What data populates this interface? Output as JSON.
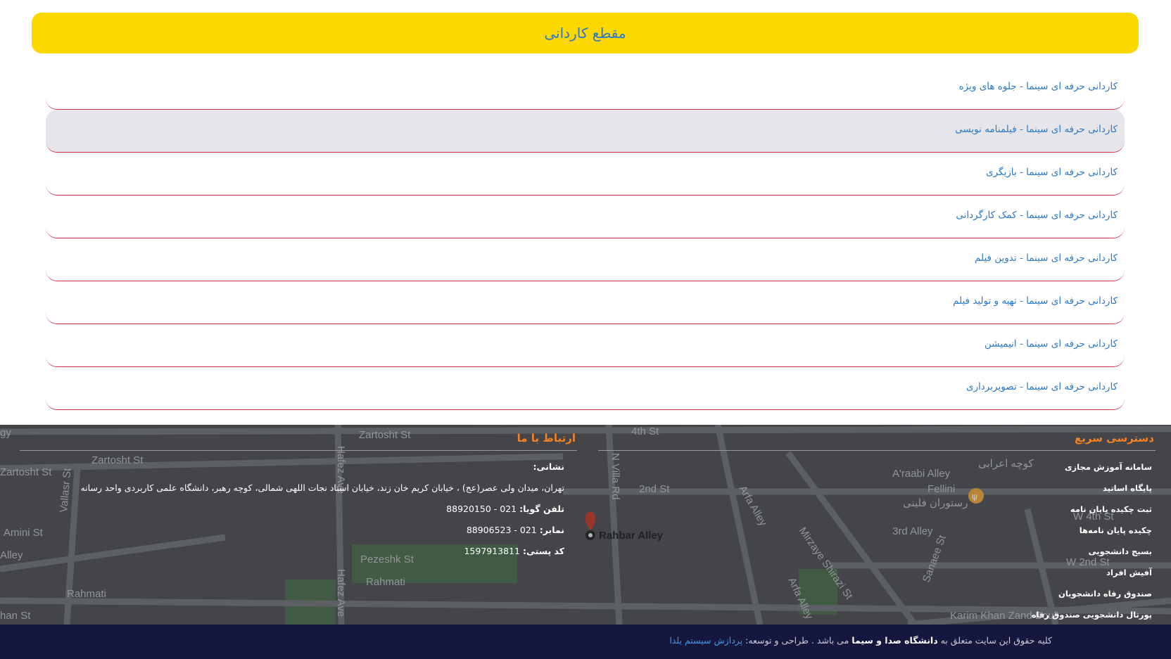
{
  "header": {
    "title": "مقطع کاردانی"
  },
  "programs": [
    "کاردانی حرفه ای سینما - جلوه های ویژه",
    "کاردانی حرفه ای سینما - فیلمنامه نویسی",
    "کاردانی حرفه ای سینما - بازیگری",
    "کاردانی حرفه ای سینما - کمک کارگردانی",
    "کاردانی حرفه ای سینما - تدوین فیلم",
    "کاردانی حرفه ای سینما - تهیه و تولید فیلم",
    "کاردانی حرفه ای سینما - انیمیشن",
    "کاردانی حرفه ای سینما - تصویربرداری"
  ],
  "quick_access": {
    "title": "دسترسی سریع",
    "links": [
      "سامانه آموزش مجازی",
      "پایگاه اساتید",
      "ثبت چکیده پایان نامه",
      "چکیده پایان نامه‌ها",
      "بسیج دانشجویی",
      "آفیش افراد",
      "صندوق رفاه دانشجویان",
      "پورتال دانشجویی صندوق رفاه"
    ]
  },
  "contact": {
    "title": "ارتباط با ما",
    "address_label": "نشانی:",
    "address": "تهران، میدان ولی عصر(عج) ، خیابان کریم خان زند، خیابان استاد نجات اللهی شمالی، کوچه رهبر، دانشگاه علمی کاربردی واحد رسانه",
    "phone_label": "تلفن گویا:",
    "phone": "021 - 88920150",
    "fax_label": "نمابر:",
    "fax": "021 - 88906523",
    "postal_label": "کد پستی:",
    "postal": "1597913811"
  },
  "map_labels": {
    "zartosht1": "Zartosht St",
    "zartosht2": "Zartosht St",
    "zartosht3": "Zartosht St",
    "fourth": "4th St",
    "second": "2nd St",
    "nvilla": "N Villa Rd",
    "hafez1": "Hafez Ave",
    "hafez2": "Hafez Ave",
    "vallasr": "Vallasr St",
    "amini": "Amini St",
    "alley": "Alley",
    "rahmati1": "Rahmati",
    "rahmati2": "Rahmati",
    "pezeshk": "Pezeshk St",
    "rahbar": "Rahbar Alley",
    "araabi": "A'raabi Alley",
    "araabi_fa": "کوچه اعرابی",
    "fellini": "Fellini",
    "fellini_fa": "رستوران فلینی",
    "w4th": "W 4th St",
    "third": "3rd Alley",
    "w2nd": "W 2nd St",
    "mirzaye": "Mirzaye Shirazi St",
    "arfa1": "Arfa Alley",
    "arfa2": "Arfa Alley",
    "sanaee": "Sanaee St",
    "karim": "Karim Khan Zand Boul",
    "han": "han St",
    "gy": "gy"
  },
  "copyright": {
    "prefix": "کلیه حقوق این سایت متعلق به",
    "brand": "دانشگاه صدا و سیما",
    "middle": "می باشد . طراحی و توسعه:",
    "dev": "پردازش سیستم یلدا"
  }
}
